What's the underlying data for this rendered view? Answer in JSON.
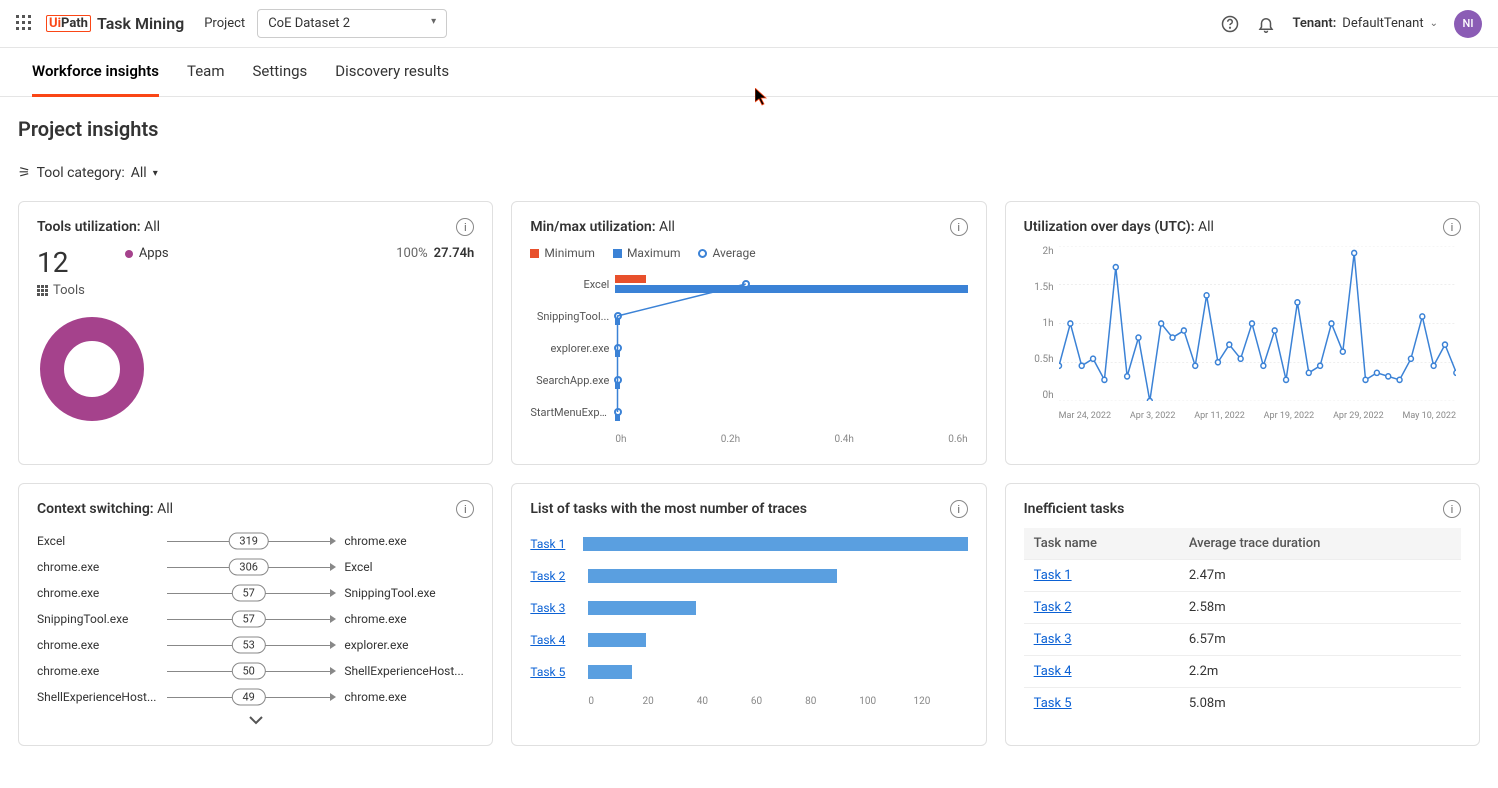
{
  "header": {
    "brand_prefix": "Ui",
    "brand_mid": "Path",
    "brand_product": "Task Mining",
    "project_label": "Project",
    "project_selected": "CoE Dataset 2",
    "tenant_label": "Tenant:",
    "tenant_value": "DefaultTenant",
    "avatar_initials": "NI"
  },
  "tabs": {
    "items": [
      "Workforce insights",
      "Team",
      "Settings",
      "Discovery results"
    ],
    "active_index": 0
  },
  "page_title": "Project insights",
  "filter": {
    "label": "Tool category:",
    "value": "All"
  },
  "tools_card": {
    "title": "Tools utilization:",
    "scope": "All",
    "count": "12",
    "sublabel": "Tools",
    "legend_label": "Apps",
    "percent": "100%",
    "hours": "27.74h",
    "donut_color": "#a5428c"
  },
  "minmax_card": {
    "title": "Min/max utilization:",
    "scope": "All",
    "legend": {
      "min": "Minimum",
      "max": "Maximum",
      "avg": "Average"
    },
    "x_ticks": [
      "0h",
      "0.2h",
      "0.4h",
      "0.6h"
    ]
  },
  "chart_data": {
    "minmax": {
      "type": "bar",
      "xlabel": "hours",
      "x_range": [
        0,
        0.7
      ],
      "series": [
        {
          "name": "Excel",
          "min": 0.06,
          "max": 0.7,
          "avg": 0.26
        },
        {
          "name": "SnippingTool...",
          "min": 0.0,
          "max": 0.01,
          "avg": 0.005
        },
        {
          "name": "explorer.exe",
          "min": 0.0,
          "max": 0.01,
          "avg": 0.005
        },
        {
          "name": "SearchApp.exe",
          "min": 0.0,
          "max": 0.01,
          "avg": 0.005
        },
        {
          "name": "StartMenuExpe...",
          "min": 0.0,
          "max": 0.01,
          "avg": 0.005
        }
      ]
    },
    "util_days": {
      "type": "line",
      "title": "Utilization over days (UTC)",
      "y_ticks": [
        "2h",
        "1.5h",
        "1h",
        "0.5h",
        "0h"
      ],
      "x_ticks": [
        "Mar 24, 2022",
        "Apr 3, 2022",
        "Apr 11, 2022",
        "Apr 19, 2022",
        "Apr 29, 2022",
        "May 10, 2022"
      ],
      "ylim": [
        0,
        2.2
      ],
      "values": [
        0.5,
        1.1,
        0.5,
        0.6,
        0.3,
        1.9,
        0.35,
        0.9,
        0.0,
        1.1,
        0.9,
        1.0,
        0.5,
        1.5,
        0.55,
        0.8,
        0.6,
        1.1,
        0.5,
        1.0,
        0.3,
        1.4,
        0.4,
        0.5,
        1.1,
        0.7,
        2.1,
        0.3,
        0.4,
        0.35,
        0.3,
        0.6,
        1.2,
        0.5,
        0.8,
        0.4
      ]
    },
    "task_traces": {
      "type": "bar",
      "x_ticks": [
        "0",
        "20",
        "40",
        "60",
        "80",
        "100",
        "120"
      ],
      "xlim": [
        0,
        130
      ],
      "series": [
        {
          "name": "Task 1",
          "value": 128
        },
        {
          "name": "Task 2",
          "value": 74
        },
        {
          "name": "Task 3",
          "value": 32
        },
        {
          "name": "Task 4",
          "value": 17
        },
        {
          "name": "Task 5",
          "value": 13
        }
      ]
    }
  },
  "util_card": {
    "title": "Utilization over days (UTC):",
    "scope": "All"
  },
  "context_card": {
    "title": "Context switching:",
    "scope": "All",
    "rows": [
      {
        "from": "Excel",
        "count": "319",
        "to": "chrome.exe"
      },
      {
        "from": "chrome.exe",
        "count": "306",
        "to": "Excel"
      },
      {
        "from": "chrome.exe",
        "count": "57",
        "to": "SnippingTool.exe"
      },
      {
        "from": "SnippingTool.exe",
        "count": "57",
        "to": "chrome.exe"
      },
      {
        "from": "chrome.exe",
        "count": "53",
        "to": "explorer.exe"
      },
      {
        "from": "chrome.exe",
        "count": "50",
        "to": "ShellExperienceHost..."
      },
      {
        "from": "ShellExperienceHost...",
        "count": "49",
        "to": "chrome.exe"
      }
    ]
  },
  "tasks_card": {
    "title": "List of tasks with the most number of traces"
  },
  "ineff_card": {
    "title": "Inefficient tasks",
    "col1": "Task name",
    "col2": "Average trace duration",
    "rows": [
      {
        "name": "Task 1",
        "dur": "2.47m"
      },
      {
        "name": "Task 2",
        "dur": "2.58m"
      },
      {
        "name": "Task 3",
        "dur": "6.57m"
      },
      {
        "name": "Task 4",
        "dur": "2.2m"
      },
      {
        "name": "Task 5",
        "dur": "5.08m"
      }
    ]
  }
}
